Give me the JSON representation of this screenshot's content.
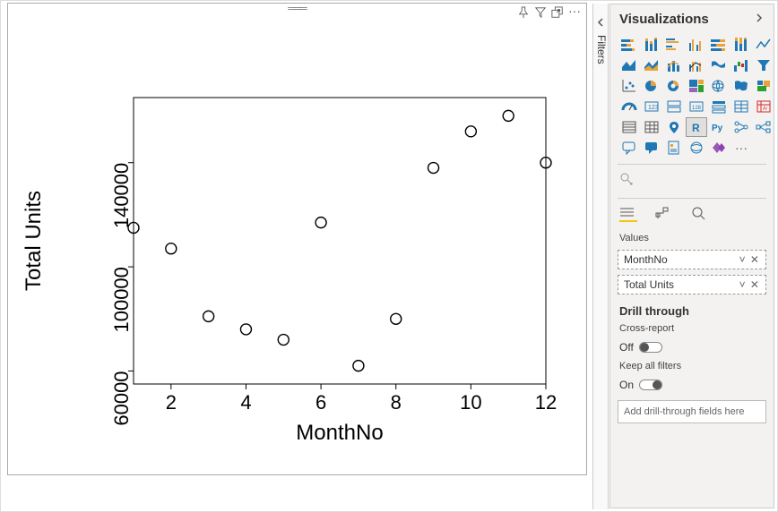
{
  "chart_data": {
    "type": "scatter",
    "xlabel": "MonthNo",
    "ylabel": "Total Units",
    "x_ticks": [
      2,
      4,
      6,
      8,
      10,
      12
    ],
    "y_ticks": [
      60000,
      100000,
      140000
    ],
    "x_range": [
      1,
      12
    ],
    "y_range": [
      55000,
      165000
    ],
    "points": [
      {
        "x": 1,
        "y": 115000
      },
      {
        "x": 2,
        "y": 107000
      },
      {
        "x": 3,
        "y": 81000
      },
      {
        "x": 4,
        "y": 76000
      },
      {
        "x": 5,
        "y": 72000
      },
      {
        "x": 6,
        "y": 117000
      },
      {
        "x": 7,
        "y": 62000
      },
      {
        "x": 8,
        "y": 80000
      },
      {
        "x": 9,
        "y": 138000
      },
      {
        "x": 10,
        "y": 152000
      },
      {
        "x": 11,
        "y": 158000
      },
      {
        "x": 12,
        "y": 140000
      }
    ]
  },
  "filters_rail": {
    "label": "Filters"
  },
  "viz_pane": {
    "title": "Visualizations",
    "fields_tab": {
      "values_label": "Values",
      "wells": [
        {
          "label": "MonthNo"
        },
        {
          "label": "Total Units"
        }
      ]
    },
    "drill": {
      "header": "Drill through",
      "cross_report_label": "Cross-report",
      "cross_report_state": "Off",
      "keep_filters_label": "Keep all filters",
      "keep_filters_state": "On",
      "drop_hint": "Add drill-through fields here"
    }
  }
}
